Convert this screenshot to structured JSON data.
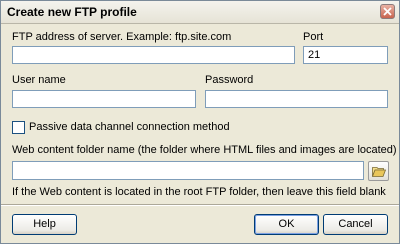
{
  "dialog": {
    "title": "Create new FTP profile",
    "close_icon": "close-icon"
  },
  "fields": {
    "ftp_address_label": "FTP address of server. Example: ftp.site.com",
    "ftp_address_value": "",
    "port_label": "Port",
    "port_value": "21",
    "username_label": "User name",
    "username_value": "",
    "password_label": "Password",
    "password_value": "",
    "passive_label": "Passive data channel connection method",
    "passive_checked": false,
    "web_folder_label": "Web content folder name (the folder where HTML files and images are located)",
    "web_folder_value": "",
    "folder_icon": "folder-open-icon",
    "hint": "If the Web content is located in the root FTP folder, then leave this field blank"
  },
  "buttons": {
    "help": "Help",
    "ok": "OK",
    "cancel": "Cancel"
  },
  "colors": {
    "dialog_bg": "#ece9d8",
    "input_border": "#7f9db9",
    "button_border": "#003c74"
  }
}
